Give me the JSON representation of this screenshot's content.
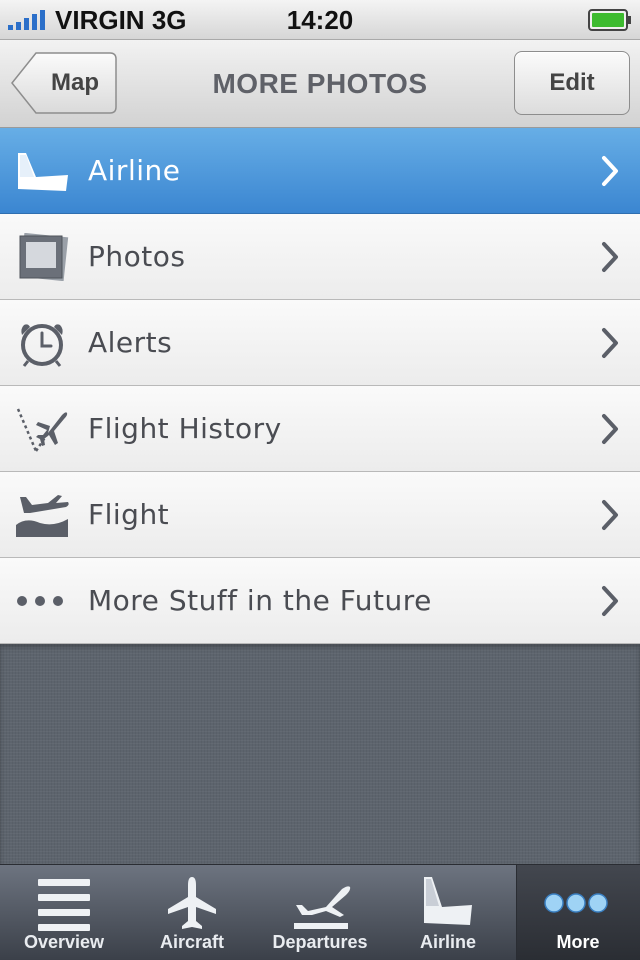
{
  "status_bar": {
    "carrier": "VIRGIN",
    "network": "3G",
    "time": "14:20"
  },
  "nav": {
    "back_label": "Map",
    "title": "MORE PHOTOS",
    "edit_label": "Edit"
  },
  "list": {
    "items": [
      {
        "label": "Airline",
        "icon": "airline-tail-icon",
        "selected": true
      },
      {
        "label": "Photos",
        "icon": "photos-icon"
      },
      {
        "label": "Alerts",
        "icon": "alarm-clock-icon"
      },
      {
        "label": "Flight History",
        "icon": "flight-history-icon"
      },
      {
        "label": "Flight",
        "icon": "plane-takeoff-icon"
      },
      {
        "label": "More Stuff in the Future",
        "icon": "ellipsis-icon"
      }
    ]
  },
  "tabbar": {
    "tabs": [
      {
        "label": "Overview",
        "icon": "list-lines-icon"
      },
      {
        "label": "Aircraft",
        "icon": "airplane-icon"
      },
      {
        "label": "Departures",
        "icon": "departures-icon"
      },
      {
        "label": "Airline",
        "icon": "airline-tail-icon"
      },
      {
        "label": "More",
        "icon": "more-dots-icon",
        "active": true
      }
    ]
  },
  "colors": {
    "selection_blue": "#3b86d1",
    "icon_gray": "#5b5f68",
    "tab_dot_blue": "#9fd3f5"
  }
}
